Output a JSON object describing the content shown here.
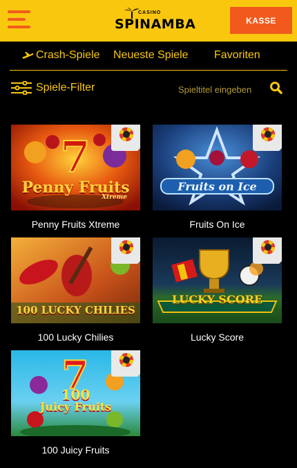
{
  "header": {
    "logo_small": "CASINO",
    "logo_brand": "SPINAMBA",
    "kasse_label": "KASSE",
    "menu_icon": "hamburger-icon"
  },
  "tabs": [
    {
      "label": "Crash-Spiele",
      "icon": "airplane-icon"
    },
    {
      "label": "Neueste Spiele"
    },
    {
      "label": "Favoriten"
    }
  ],
  "filter": {
    "label": "Spiele-Filter",
    "icon": "sliders-icon"
  },
  "search": {
    "placeholder": "Spieltitel eingeben",
    "icon": "search-icon"
  },
  "games": [
    {
      "name": "Penny Fruits Xtreme",
      "art_title": "Penny Fruits",
      "art_sub": "Xtreme"
    },
    {
      "name": "Fruits On Ice",
      "art_title": "Fruits on Ice"
    },
    {
      "name": "100 Lucky Chilies",
      "art_title": "100 LUCKY CHILIES"
    },
    {
      "name": "Lucky Score",
      "art_title": "LUCKY SCORE"
    },
    {
      "name": "100 Juicy Fruits",
      "art_title": "100",
      "art_sub": "Juicy Fruits"
    }
  ],
  "colors": {
    "accent_yellow": "#f9c80e",
    "accent_orange": "#f25a1d",
    "background": "#000000"
  }
}
